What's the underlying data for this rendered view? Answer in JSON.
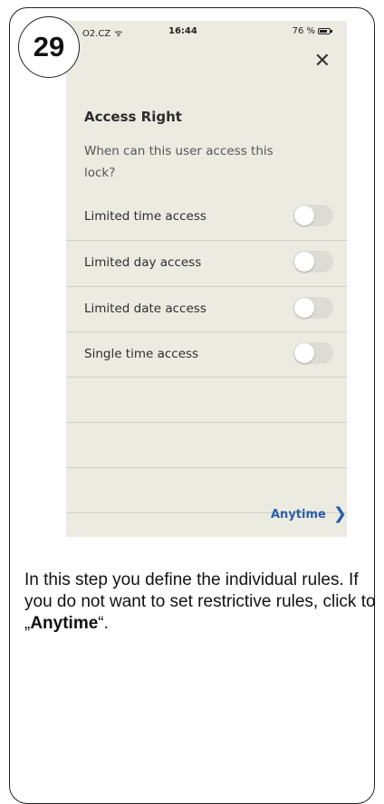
{
  "step_number": "29",
  "status_bar": {
    "carrier": "O2.CZ",
    "time": "16:44",
    "battery": "76 %"
  },
  "close_icon": "✕",
  "access_right": {
    "title": "Access Right",
    "subtitle": "When can this user access this lock?"
  },
  "options": [
    {
      "label": "Limited time access",
      "enabled": false
    },
    {
      "label": "Limited day access",
      "enabled": false
    },
    {
      "label": "Limited date access",
      "enabled": false
    },
    {
      "label": "Single time access",
      "enabled": false
    }
  ],
  "footer": {
    "anytime_label": "Anytime",
    "chevron": "❯"
  },
  "instructions": {
    "text_before": "In this step you define the individual rules. If you do not want to set restrictive rules, click to „",
    "highlight": "Anytime",
    "text_after": "“."
  },
  "colors": {
    "screen_background": "#ecebe2",
    "accent": "#2a5ea8",
    "toggle_off": "#dddcd4"
  }
}
